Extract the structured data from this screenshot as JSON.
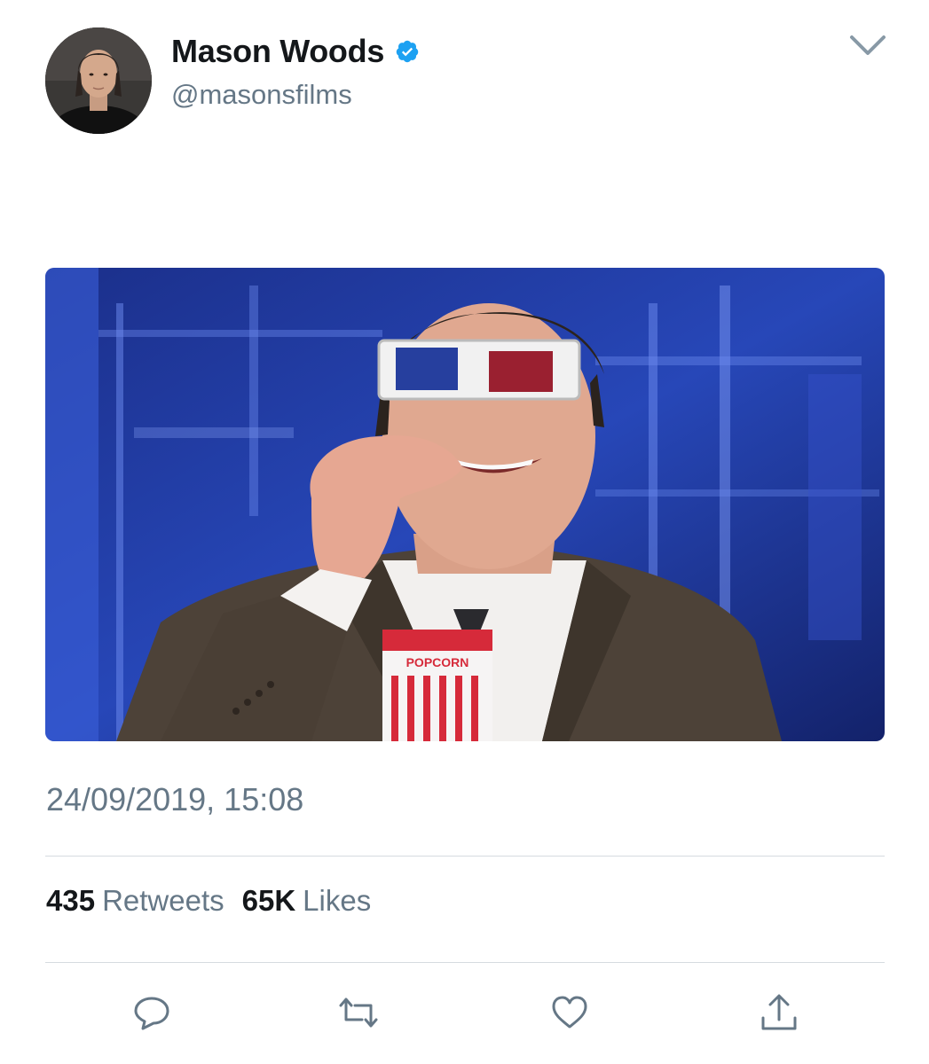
{
  "tweet": {
    "author": {
      "display_name": "Mason Woods",
      "handle": "@masonsfilms",
      "verified": true,
      "avatar_icon": "profile-photo"
    },
    "menu_icon": "chevron-down-icon",
    "media": {
      "type": "gif",
      "description_icon": "popcorn-3d-glasses-gif",
      "popcorn_box_text": "POPCORN"
    },
    "timestamp": "24/09/2019, 15:08",
    "stats": {
      "retweets_count": "435",
      "retweets_label": "Retweets",
      "likes_count": "65K",
      "likes_label": "Likes"
    },
    "actions": [
      {
        "name": "reply",
        "icon": "reply-icon"
      },
      {
        "name": "retweet",
        "icon": "retweet-icon"
      },
      {
        "name": "like",
        "icon": "heart-icon"
      },
      {
        "name": "share",
        "icon": "share-icon"
      }
    ]
  },
  "colors": {
    "primary_text": "#14171a",
    "secondary_text": "#657786",
    "verified_blue": "#1da1f2",
    "divider": "#d6dbe0",
    "icon_gray": "#657786"
  }
}
